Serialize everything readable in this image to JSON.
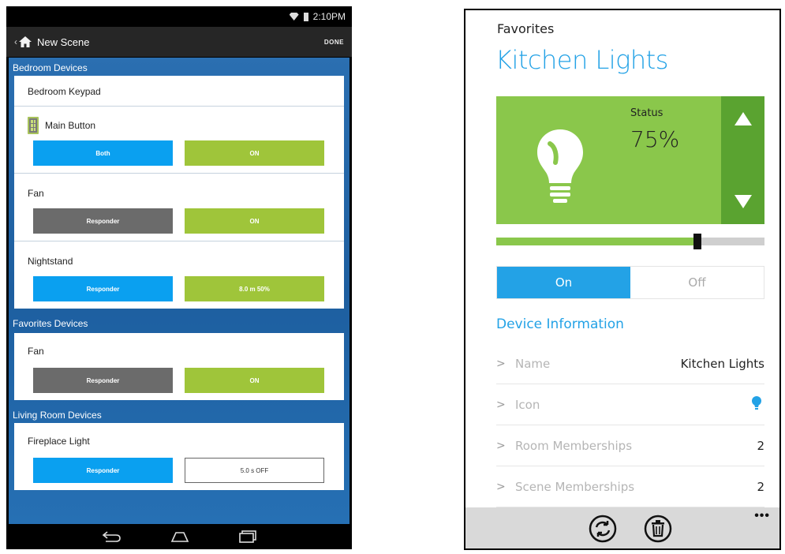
{
  "android": {
    "status_time": "2:10PM",
    "action_title": "New Scene",
    "done_label": "DONE",
    "sections": [
      {
        "header": "Bedroom Devices",
        "card_title": "Bedroom Keypad",
        "devices": [
          {
            "name": "Main Button",
            "left_btn": "Both",
            "right_btn": "ON"
          },
          {
            "name": "Fan",
            "left_btn": "Responder",
            "right_btn": "ON"
          },
          {
            "name": "Nightstand",
            "left_btn": "Responder",
            "right_btn": "8.0 m   50%"
          }
        ]
      },
      {
        "header": "Favorites Devices",
        "devices": [
          {
            "name": "Fan",
            "left_btn": "Responder",
            "right_btn": "ON"
          }
        ]
      },
      {
        "header": "Living Room Devices",
        "devices": [
          {
            "name": "Fireplace Light",
            "left_btn": "Responder",
            "right_btn": "5.0 s   OFF"
          }
        ]
      }
    ],
    "icons": [
      "wifi-icon",
      "battery-icon",
      "chevron-left-icon",
      "home-icon",
      "keypad-icon",
      "back-icon",
      "home-nav-icon",
      "recent-apps-icon"
    ],
    "colors": {
      "blue": "#0aa0f0",
      "grey": "#6b6b6b",
      "green": "#9fc53a",
      "header_bg": "#1d5e9f"
    }
  },
  "winphone": {
    "app_name": "Favorites",
    "page_title": "Kitchen Lights",
    "status_label": "Status",
    "status_value": "75%",
    "brightness_fraction": 0.75,
    "toggle_on": "On",
    "toggle_off": "Off",
    "section_title": "Device Information",
    "info_rows": [
      {
        "label": "Name",
        "value": "Kitchen Lights"
      },
      {
        "label": "Icon",
        "value_icon": "lightbulb-pin-icon"
      },
      {
        "label": "Room Memberships",
        "value": "2"
      },
      {
        "label": "Scene Memberships",
        "value": "2"
      }
    ],
    "appbar_more": "•••",
    "icons": [
      "lightbulb-icon",
      "arrow-up-icon",
      "arrow-down-icon",
      "sync-icon",
      "delete-icon",
      "chevron-right-icon"
    ],
    "colors": {
      "accent": "#23a2e6",
      "tile": "#8ac74b",
      "tile_dark": "#5aa330"
    }
  }
}
